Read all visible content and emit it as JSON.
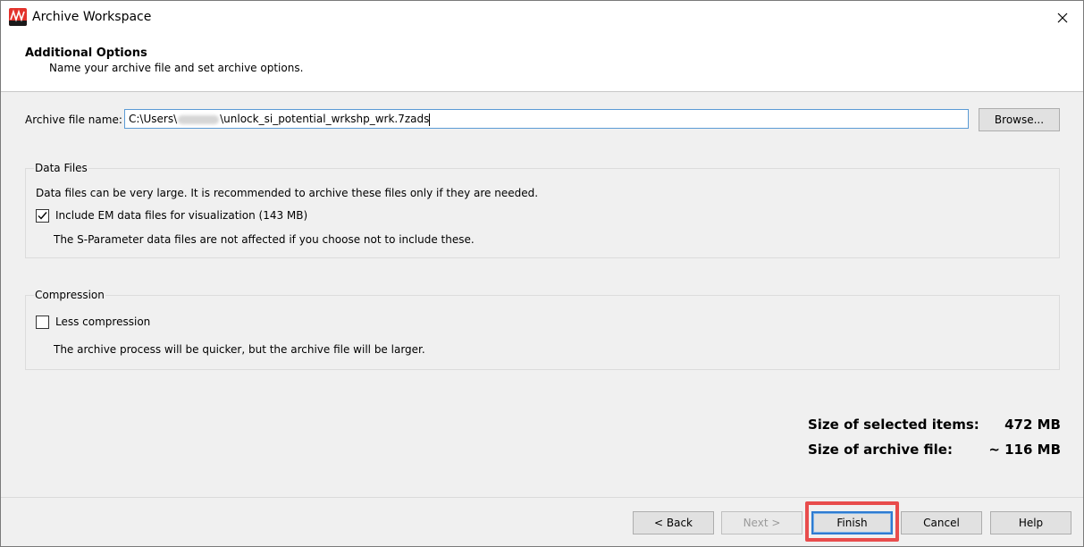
{
  "window": {
    "title": "Archive Workspace",
    "icon": "app-logo-icon",
    "close_icon": "close-icon"
  },
  "header": {
    "title": "Additional Options",
    "subtitle": "Name your archive file and set archive options."
  },
  "archive": {
    "label": "Archive file name:",
    "path_prefix": "C:\\Users\\",
    "path_suffix": "\\unlock_si_potential_wrkshp_wrk.7zads",
    "browse_label": "Browse..."
  },
  "data_files": {
    "group_title": "Data Files",
    "description": "Data files can be very large. It is recommended to archive these files only if they are needed.",
    "checkbox_label": "Include EM data files for visualization (143 MB)",
    "checked": true,
    "note": "The S-Parameter data files are not affected if you choose not to include these."
  },
  "compression": {
    "group_title": "Compression",
    "checkbox_label": "Less compression",
    "checked": false,
    "note": "The archive process will be quicker, but the archive file will be larger."
  },
  "sizes": {
    "selected_label": "Size of selected items:",
    "selected_value": "472 MB",
    "archive_label": "Size of archive file:",
    "archive_value": "~ 116 MB"
  },
  "footer": {
    "back_label": "< Back",
    "next_label": "Next >",
    "finish_label": "Finish",
    "cancel_label": "Cancel",
    "help_label": "Help"
  },
  "colors": {
    "highlight": "#e84c4c",
    "accent": "#2e7bd1",
    "app_icon": "#e3322b"
  }
}
